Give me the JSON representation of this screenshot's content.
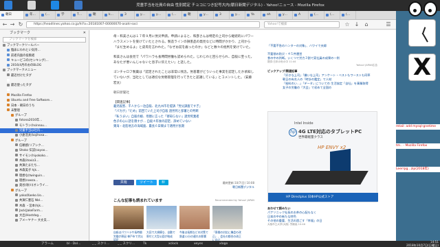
{
  "window": {
    "title": "児童手当を社員の自由  性別認定 チョコにつき記号大内(朝日新聞デジタル) - Yahoo!ニュース - Mozilla Firefox"
  },
  "tabs": [
    "朝日",
    "年…",
    "(…",
    "学",
    "T…",
    "朝",
    "k…",
    "3",
    "y…",
    "y…",
    "(…",
    "朝",
    "y…",
    "3",
    "y…",
    "Ya",
    "ah",
    "y…",
    "A",
    "(…",
    "(…",
    "(…"
  ],
  "nav": {
    "url": "https://headlines.yahoo.co.jp/hl?a=20181007-00000070-asahi-soci",
    "search_placeholder": "Yahoo!で検索"
  },
  "sidebar": {
    "title": "ブックマーク",
    "search_placeholder": "ブックマークを検索",
    "items": [
      {
        "label": "ブックマークツールバー",
        "level": 0,
        "color": "#8a8a8a"
      },
      {
        "label": "臨床にわれとい気持…",
        "level": 1,
        "color": "#5b8fd6"
      },
      {
        "label": "前者内面の投稿者",
        "level": 1,
        "color": "#5b8fd6"
      },
      {
        "label": "キュービコの(センキング)…",
        "level": 1,
        "color": "#5b8fd6"
      },
      {
        "label": "2016/4月のおのBLOG",
        "level": 1,
        "color": "#5b8fd6"
      },
      {
        "label": "ブックマークメニュー",
        "level": 0,
        "color": "#8a8a8a"
      },
      {
        "label": "最近付けたタグ",
        "level": 1,
        "color": "#888"
      },
      {
        "label": "",
        "level": 1,
        "color": "#fff"
      },
      {
        "label": "最近使ったタグ",
        "level": 1,
        "color": "#888"
      },
      {
        "label": "",
        "level": 1,
        "color": "#fff"
      },
      {
        "label": "Mozilla Firefox",
        "level": 1,
        "color": "#d9822b"
      },
      {
        "label": "Ubuntu and Free Software…",
        "level": 1,
        "color": "#d9822b"
      },
      {
        "label": "日本 - 朝日のうち",
        "level": 1,
        "color": "#d9822b"
      },
      {
        "label": "未整理",
        "level": 1,
        "color": "#d9822b"
      },
      {
        "label": "グループ",
        "level": 2,
        "color": "#d9822b"
      },
      {
        "label": "fotona2016年…",
        "level": 3,
        "color": "#888"
      },
      {
        "label": "モトラン(hsinnou…",
        "level": 3,
        "color": "#888"
      },
      {
        "label": "児童手当は社内…",
        "level": 3,
        "color": "#888",
        "selected": true
      },
      {
        "label": "小倉浩太(kojihosa…",
        "level": 3,
        "color": "#888"
      },
      {
        "label": "グループ",
        "level": 2,
        "color": "#d9822b"
      },
      {
        "label": "信頼感(リアンク…",
        "level": 3,
        "color": "#888"
      },
      {
        "label": "Shoko 伝説(sayoo…",
        "level": 3,
        "color": "#888"
      },
      {
        "label": "サイモン(hiyokoko…",
        "level": 3,
        "color": "#888"
      },
      {
        "label": "木森(itoxiz3…",
        "level": 3,
        "color": "#888"
      },
      {
        "label": "共演たまたち…",
        "level": 3,
        "color": "#888"
      },
      {
        "label": "木森美子 hjk…",
        "level": 3,
        "color": "#888"
      },
      {
        "label": "理想な(twinguin…",
        "level": 3,
        "color": "#888"
      },
      {
        "label": "理想(naeza…",
        "level": 3,
        "color": "#888"
      },
      {
        "label": "奥谷(秋川(オンライ…",
        "level": 3,
        "color": "#888"
      },
      {
        "label": "グループ",
        "level": 2,
        "color": "#d9822b"
      },
      {
        "label": "yoko(Kaeko.Uo…",
        "level": 3,
        "color": "#888"
      },
      {
        "label": "共演仁豊石 Nbl…",
        "level": 3,
        "color": "#888"
      },
      {
        "label": "木森 ・宮本(hjk…",
        "level": 3,
        "color": "#888"
      },
      {
        "label": "Jack(JakeFarm…",
        "level": 3,
        "color": "#888"
      },
      {
        "label": "大出(Hostdog…",
        "level": 3,
        "color": "#888"
      },
      {
        "label": "アメーヤナー 大丈夫…",
        "level": 3,
        "color": "#888"
      }
    ]
  },
  "article": {
    "paragraphs": [
      "母・和美さんは１７年９月に労災申請。申請によると、和彦さんは特定の上司から継続的にパワーハラスメントを受けていたとされる。製造ラインの損害品の発見などに時間がかかり、上司から「まだ生めるよ」と皮肉を言われた。「なぜお前を雇ったのか」などと数々の批判を受けていた。",
      "和美さんは会見で「パワハラも長時間労働も認められた。じわじわと回らせられ、自殺に至った。あなたが悪いんじゃないと息子に伝えたい」と話した。",
      "ゴンチャロフ製菓は「認定されたことは非常に残念。労基署がどういった事実を認定したか承知していないが、当社としては適切な労務管理を行ってきたと認識している」とコメントした。（安藤宏太）",
      "朝日新聞社"
    ],
    "related_title": "【関連記事】",
    "related": [
      "義児殺害、千人から一泊自殺、北九州市を提訴「労災調査ですぎ」",
      "「パカが」「ため」前回ていた上司が自殺 過労死と部署との判断",
      "「私うまい」自殺の娘、母親に言った「寄知らない」過労死業者",
      "色子の心に話を隠すが… 自殺４年後の認定、諦めていない",
      "東海・北陸地方の海域面、最長６日間まで適用が長期"
    ],
    "share": [
      "共有",
      "ツイート",
      "B!"
    ],
    "source_line1": "最終更新:10/7(日) 10:08",
    "source_line2": "朝日新聞デジタル",
    "rec_title": "こんな記事も読まれています",
    "rec_note": "Recommended by Yahoo! JAPAN",
    "recs": [
      "自殺はパワハラや長時間労働が原因 神戸市で労災認定",
      "大田で大規模な、自動で寄付と大型公園が結成",
      "今後は長期などの対策で鉄道12分の遅れの影響",
      "「昼間の対応に機会の改正」、会社の都合の改正に向け",
      "市長として出した社内対策と自己責任"
    ]
  },
  "right_column": {
    "top_items": [
      "「不要不急のハンターの対象」、ハワイで夫婦",
      "不要領の防災・４５件運営",
      "食の中の判断。いくつで労力３割で実社員の成果の一例"
    ],
    "top_sub": "提供:日本の世の中 11:44",
    "ad_label": "Yahoo! JAPAN広告",
    "ranking_title": "ピックアップ/関連記事",
    "ranking": [
      "「好きな上司」「嫌いな上司」アンケート・ベストもワーストも同率",
      "朝日の有名人の「時計の鑑定」で人材",
      "「給料のい…」「データ」についての 生活協定「自社」を事業取得",
      "女子の労働の「大会」で初めて全国の"
    ],
    "ad_brand": "Intel Inside",
    "ad_head": "4G LTE対応のタブレットPC",
    "ad_sub": "世界最軽量クラス",
    "ad_product": "HP ENVY x2",
    "ad_footer": "HP Directplus 日本HP公式ストア",
    "below_ad": [
      "パナソニック社長のお茶の心配もなく",
      "日本の中の新たな特色",
      "その他の重要、生活の過ごす「幸福」の日",
      "大阪市立大学(大阪) 労働協 10:46"
    ],
    "below_title": "あわせて読みたい"
  },
  "taskbar": {
    "items": [
      "アラーム",
      "bl - Dol…",
      "_ _ スクリ…",
      "_ _ スクリ…",
      "Tk",
      "xclock",
      "xeyes",
      "xlogo"
    ],
    "clock_line1": "14:51",
    "clock_line2": "2018年10月7日(日曜日)"
  },
  "desktop": {
    "lines": [
      "mtail: add mysql-gnetime",
      "tm.. - Mozilla Firefox",
      "Leerrpg…zip(2018年)"
    ]
  }
}
